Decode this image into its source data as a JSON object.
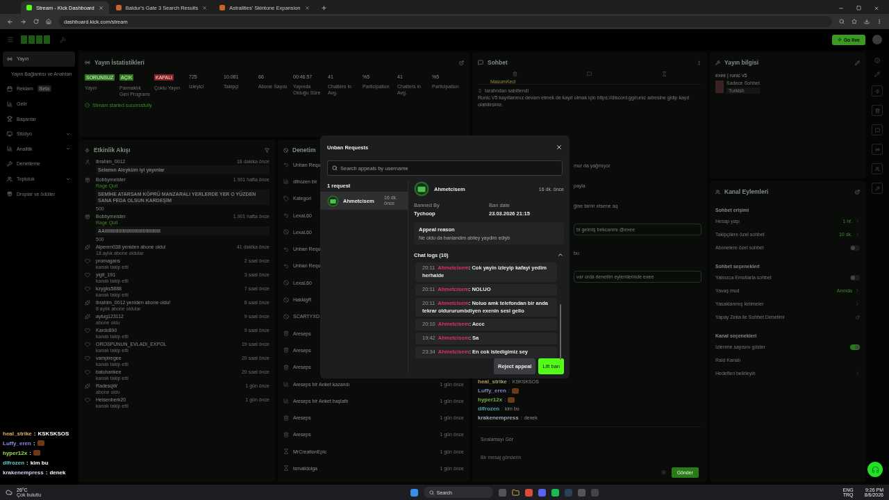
{
  "browser": {
    "tabs": [
      {
        "title": "Stream - Kick Dashboard",
        "selected": true
      },
      {
        "title": "Baldur's Gate 3 Search Results",
        "selected": false
      },
      {
        "title": "Astralities' Skintone Expansion",
        "selected": false
      }
    ],
    "url": "dashboard.kick.com/stream"
  },
  "header": {
    "go_live": "Go live"
  },
  "sidebar": {
    "items": [
      {
        "label": "Yayın",
        "kind": "link",
        "selected": true
      },
      {
        "label": "Yayın Bağlantısı ve Anahtarı",
        "kind": "sub",
        "selected": false
      },
      {
        "label": "Reklam",
        "kind": "link",
        "badge": "Beta",
        "selected": false
      },
      {
        "label": "Gelir",
        "kind": "link",
        "selected": false
      },
      {
        "label": "Başarılar",
        "kind": "link",
        "selected": false
      },
      {
        "label": "Stüdyo",
        "kind": "group",
        "selected": false
      },
      {
        "label": "Analitik",
        "kind": "group",
        "selected": false
      },
      {
        "label": "Denetleme",
        "kind": "link",
        "selected": false
      },
      {
        "label": "Topluluk",
        "kind": "group",
        "selected": false
      },
      {
        "label": "Droplar ve ödüller",
        "kind": "link",
        "selected": false
      }
    ]
  },
  "stats": {
    "title": "Yayın İstatistikleri",
    "items": [
      {
        "kind": "badge",
        "value": "SORUNSUZ",
        "label": "Yayın",
        "color": "#2a7a1a"
      },
      {
        "kind": "badge",
        "value": "AÇIK",
        "label": "Parmaklık Geri Programı",
        "color": "#2a7a1a"
      },
      {
        "kind": "badge",
        "value": "KAPALI",
        "label": "Çoklu Yayın",
        "color": "#8a2020"
      },
      {
        "kind": "number",
        "value": "725",
        "label": "İzleyici"
      },
      {
        "kind": "number",
        "value": "10.081",
        "label": "Takipçi"
      },
      {
        "kind": "number",
        "value": "66",
        "label": "Abone Sayısı"
      },
      {
        "kind": "number",
        "value": "00:46:57",
        "label": "Yayında Olduğu Süre"
      },
      {
        "kind": "number",
        "value": "41",
        "label": "Chatters in Avg."
      },
      {
        "kind": "number",
        "value": "%5",
        "label": "Participation"
      },
      {
        "kind": "number",
        "value": "41",
        "label": "Chatters in Avg."
      },
      {
        "kind": "number",
        "value": "%5",
        "label": "Participation"
      }
    ],
    "status": "Stream started successfully."
  },
  "activity": {
    "title": "Etkinlik Akışı",
    "items": [
      {
        "kind": "sub",
        "name": "ibrahim_0012",
        "time": "18 dakika önce",
        "message": "Selamın Aleyküm iyi yayınlar"
      },
      {
        "kind": "gift",
        "name": "Bobbymeister",
        "tag": "Rage Quit",
        "time": "1.901 hafta önce",
        "message": "SEMİHE ATARSAM KÖPRÜ MANZARALI YERLERDE YER O YÜZDEN SANA FEDA OLSUN KARDEŞİM",
        "amount": "500"
      },
      {
        "kind": "gift",
        "name": "Bobbymeister",
        "tag": "Rage Quit",
        "time": "1.901 hafta önce",
        "message": "AAIIIIIIIIIIIIIIIIIIIIIIIIIIIIIIIIIIIIIIIII",
        "amount": "500"
      },
      {
        "kind": "resub",
        "name": "Alperen038 yeniden abone oldu!",
        "time": "41 dakika önce",
        "detail": "18 aylık abone oldular"
      },
      {
        "kind": "follow",
        "name": "promagans",
        "time": "2 saat önce",
        "detail": "kanalı takip etti"
      },
      {
        "kind": "follow",
        "name": "yigit_191",
        "time": "3 saat önce",
        "detail": "kanalı takip etti"
      },
      {
        "kind": "follow",
        "name": "kzygks5888",
        "time": "7 saat önce",
        "detail": "kanalı takip etti"
      },
      {
        "kind": "resub",
        "name": "ibrahim_0012 yeniden abone oldu!",
        "time": "8 saat önce",
        "detail": "8 aylık abone oldular"
      },
      {
        "kind": "resub",
        "name": "aytug123112",
        "time": "9 saat önce",
        "detail": "abone oldu"
      },
      {
        "kind": "follow",
        "name": "Kardo890",
        "time": "9 saat önce",
        "detail": "kanalı takip etti"
      },
      {
        "kind": "follow",
        "name": "OROSPUNUN_EVLADI_EXPOL",
        "time": "19 saat önce",
        "detail": "kanalı takip etti"
      },
      {
        "kind": "follow",
        "name": "vampiregee",
        "time": "20 saat önce",
        "detail": "kanalı takip etti"
      },
      {
        "kind": "follow",
        "name": "batuhankee",
        "time": "20 saat önce",
        "detail": "kanalı takip etti"
      },
      {
        "kind": "resub",
        "name": "RadesqW",
        "time": "1 gün önce",
        "detail": "abone oldu"
      },
      {
        "kind": "follow",
        "name": "Heisenberk20",
        "time": "1 gün önce",
        "detail": "kanalı takip etti"
      }
    ]
  },
  "moderation": {
    "title": "Denetim",
    "items": [
      {
        "kind": "unban",
        "title": "Unban Requ"
      },
      {
        "kind": "poll",
        "title": "dlfrozen bir"
      },
      {
        "kind": "category",
        "title": "Kategori"
      },
      {
        "kind": "unban",
        "title": "LexaL60"
      },
      {
        "kind": "ban",
        "title": "LexaL60"
      },
      {
        "kind": "unban",
        "title": "Unban Requ"
      },
      {
        "kind": "unban",
        "title": "Unban Requ"
      },
      {
        "kind": "ban",
        "title": "LexaL60"
      },
      {
        "kind": "ban",
        "title": "HakkigR"
      },
      {
        "kind": "ban",
        "title": "SCARTYXD"
      },
      {
        "kind": "delete",
        "title": "Areseps"
      },
      {
        "kind": "delete",
        "title": "Areseps"
      },
      {
        "kind": "delete",
        "title": "Areseps"
      },
      {
        "kind": "poll",
        "title": "Areseps bir Anket kazandı",
        "time": "1 gün önce"
      },
      {
        "kind": "poll",
        "title": "Areseps bir Anket başlattı",
        "time": "1 gün önce"
      },
      {
        "kind": "delete",
        "title": "Areseps",
        "time": "1 gün önce"
      },
      {
        "kind": "delete",
        "title": "Areseps",
        "time": "1 gün önce"
      },
      {
        "kind": "slow",
        "title": "MrCreationEpic",
        "time": "1 gün önce"
      },
      {
        "kind": "slow",
        "title": "ismaildolga",
        "time": "1 gün önce"
      }
    ]
  },
  "chat": {
    "title": "Sohbet",
    "top_user": "MasumKeci",
    "pinned_by": "tarafından sabitlendi",
    "pinned": "Runic V5 kayıtlarımız devam etmek de kayıt olmak için https://discord.gg/runic adresine gidip kayıt olabilirsiniz.",
    "fragments": [
      {
        "kind": "plain",
        "text": "mur da yağmıyor"
      },
      {
        "kind": "plain",
        "text": "payla"
      },
      {
        "kind": "plain",
        "text": "ğine tamir etsene aq"
      },
      {
        "kind": "boxed",
        "text": "bi gelmiş bekcanmı @exee"
      },
      {
        "kind": "plain",
        "text": "bu"
      },
      {
        "kind": "boxed",
        "text": "var orda denetim eylemlerinde exee"
      }
    ],
    "separator": ":",
    "messages": [
      {
        "user": "heal_strike",
        "text": "KSKSKSOS",
        "color": "#b09a6a"
      },
      {
        "user": "Luffy_eren",
        "color": "#8080c8"
      },
      {
        "user": "hyper12x",
        "color": "#78b048"
      },
      {
        "user": "dlfrozen",
        "text": "kim bu",
        "color": "#50a0b0"
      },
      {
        "user": "krakenempress",
        "text": "denek",
        "color": "#a0a0b8"
      }
    ],
    "leaderboard": "Sıralamayı Gör",
    "input_placeholder": "Bir mesaj gönderin",
    "send": "Gönder"
  },
  "stream_info": {
    "title": "Yayın bilgisi",
    "stream_title": "exee | runic v5",
    "category": "Sadece Sohbet",
    "language": "Turkish"
  },
  "channel_actions": {
    "title": "Kanal Eylemleri",
    "sections": [
      {
        "title": "Sohbet erişimi",
        "rows": [
          {
            "kind": "link",
            "label": "Hesap yaşı",
            "value": "1 hf."
          },
          {
            "kind": "link",
            "label": "Takipçilere özel sohbet",
            "value": "10 dk."
          },
          {
            "kind": "toggle",
            "label": "Abonelere özel sohbet",
            "on": false
          }
        ]
      },
      {
        "title": "Sohbet seçenekleri",
        "rows": [
          {
            "kind": "toggle",
            "label": "Yalnızca Emotlarla sohbet",
            "on": false
          },
          {
            "kind": "link",
            "label": "Yavaş mod",
            "value": "Anında"
          },
          {
            "kind": "link",
            "label": "Yasaklanmış kelimeler"
          },
          {
            "kind": "external",
            "label": "Yapay Zeka ile Sohbet Denetimi"
          }
        ]
      },
      {
        "title": "Kanal seçenekleri",
        "rows": [
          {
            "kind": "toggle",
            "label": "İzlenme sayısını göster",
            "on": true
          },
          {
            "kind": "plain",
            "label": "Raid Kanalı"
          },
          {
            "kind": "link",
            "label": "Hedefleri belirleyin"
          }
        ]
      }
    ]
  },
  "overlay_chat": {
    "separator": ":",
    "lines": [
      {
        "user": "heal_strike",
        "text": "KSKSKSOS",
        "color": "#e0b070"
      },
      {
        "user": "Luffy_eren",
        "color": "#8c8cf0"
      },
      {
        "user": "hyper12x",
        "color": "#9ce04a"
      },
      {
        "user": "dlfrozen",
        "text": "kim bu",
        "color": "#5ad0c8"
      },
      {
        "user": "krakenempress",
        "text": "denek",
        "color": "#d8d8f0"
      }
    ]
  },
  "modal": {
    "title": "Unban Requests",
    "search_placeholder": "Search appeals by username",
    "count": "1 request",
    "requests": [
      {
        "name": "Ahmetcisem",
        "time": "16 dk. önce",
        "selected": true
      }
    ],
    "detail": {
      "name": "Ahmetcisem",
      "time": "16 dk. önce",
      "banned_by_label": "Banned By",
      "banned_by": "Tychoop",
      "ban_date_label": "Ban date",
      "ban_date": "23.03.2026 21:15",
      "reason_label": "Appeal reason",
      "reason": "Ne oldu da banlandim abiley yaydim ediyb",
      "logs_title": "Chat logs (10)",
      "logs_expanded": true,
      "logs": [
        {
          "time": "20:11",
          "user": "Ahmetcisem",
          "text": ": Cok yayin izleyip kafayi yedim herhalde"
        },
        {
          "time": "20:11",
          "user": "Ahmetcisem",
          "text": ": NOLUO"
        },
        {
          "time": "20:11",
          "user": "Ahmetcisem",
          "text": ": Noluo amk telefondan bir anda tekrar oldururumbdiyen exenin sesi gelio"
        },
        {
          "time": "20:10",
          "user": "Ahmetcisem",
          "text": ": Accc"
        },
        {
          "time": "19:42",
          "user": "Ahmetcisem",
          "text": ": Sa"
        },
        {
          "time": "23:34",
          "user": "Ahmetcisem",
          "text": ": En cok istedigimiz sey"
        }
      ]
    },
    "reject": "Reject appeal",
    "lift": "Lift ban"
  },
  "taskbar": {
    "temp": "26°C",
    "weather": "Çok bulutlu",
    "search": "Search",
    "lang1": "ENG",
    "lang2": "TRQ",
    "time": "9:26 PM",
    "date": "8/6/2026"
  }
}
